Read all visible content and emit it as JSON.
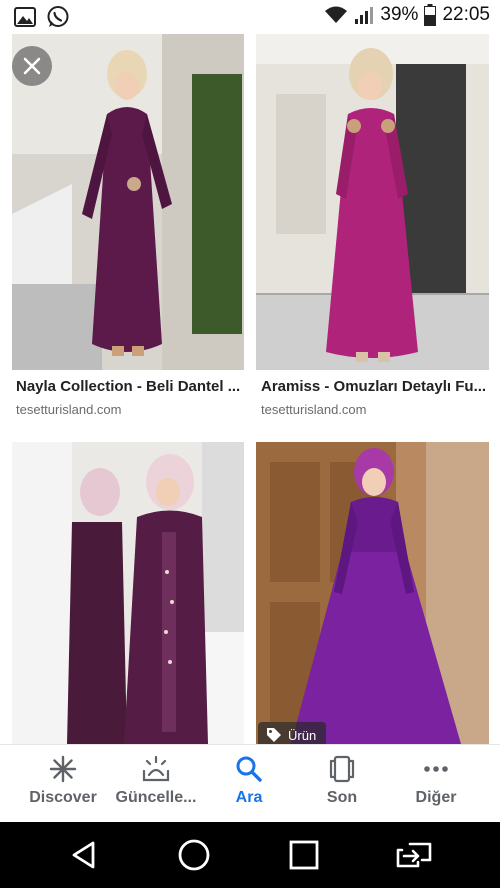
{
  "status_bar": {
    "battery_percent": "39%",
    "time": "22:05",
    "icons": [
      "gallery-icon",
      "whatsapp-icon",
      "wifi-icon",
      "signal-icon",
      "battery-icon"
    ]
  },
  "results": [
    {
      "title": "Nayla Collection - Beli Dantel ...",
      "source": "tesetturisland.com"
    },
    {
      "title": "Aramiss - Omuzları Detaylı Fu...",
      "source": "tesetturisland.com"
    },
    {
      "title": "",
      "source": ""
    },
    {
      "title": "",
      "source": "",
      "badge": "Ürün"
    }
  ],
  "bottom_nav": {
    "items": [
      {
        "label": "Discover",
        "icon": "asterisk-icon"
      },
      {
        "label": "Güncelle...",
        "icon": "updates-icon"
      },
      {
        "label": "Ara",
        "icon": "search-icon",
        "active": true
      },
      {
        "label": "Son",
        "icon": "recent-icon"
      },
      {
        "label": "Diğer",
        "icon": "more-icon"
      }
    ]
  },
  "colors": {
    "accent": "#1a73e8",
    "dress_plum": "#5c1a4a",
    "dress_magenta": "#b0237a",
    "dress_purple": "#6a1b8e"
  }
}
